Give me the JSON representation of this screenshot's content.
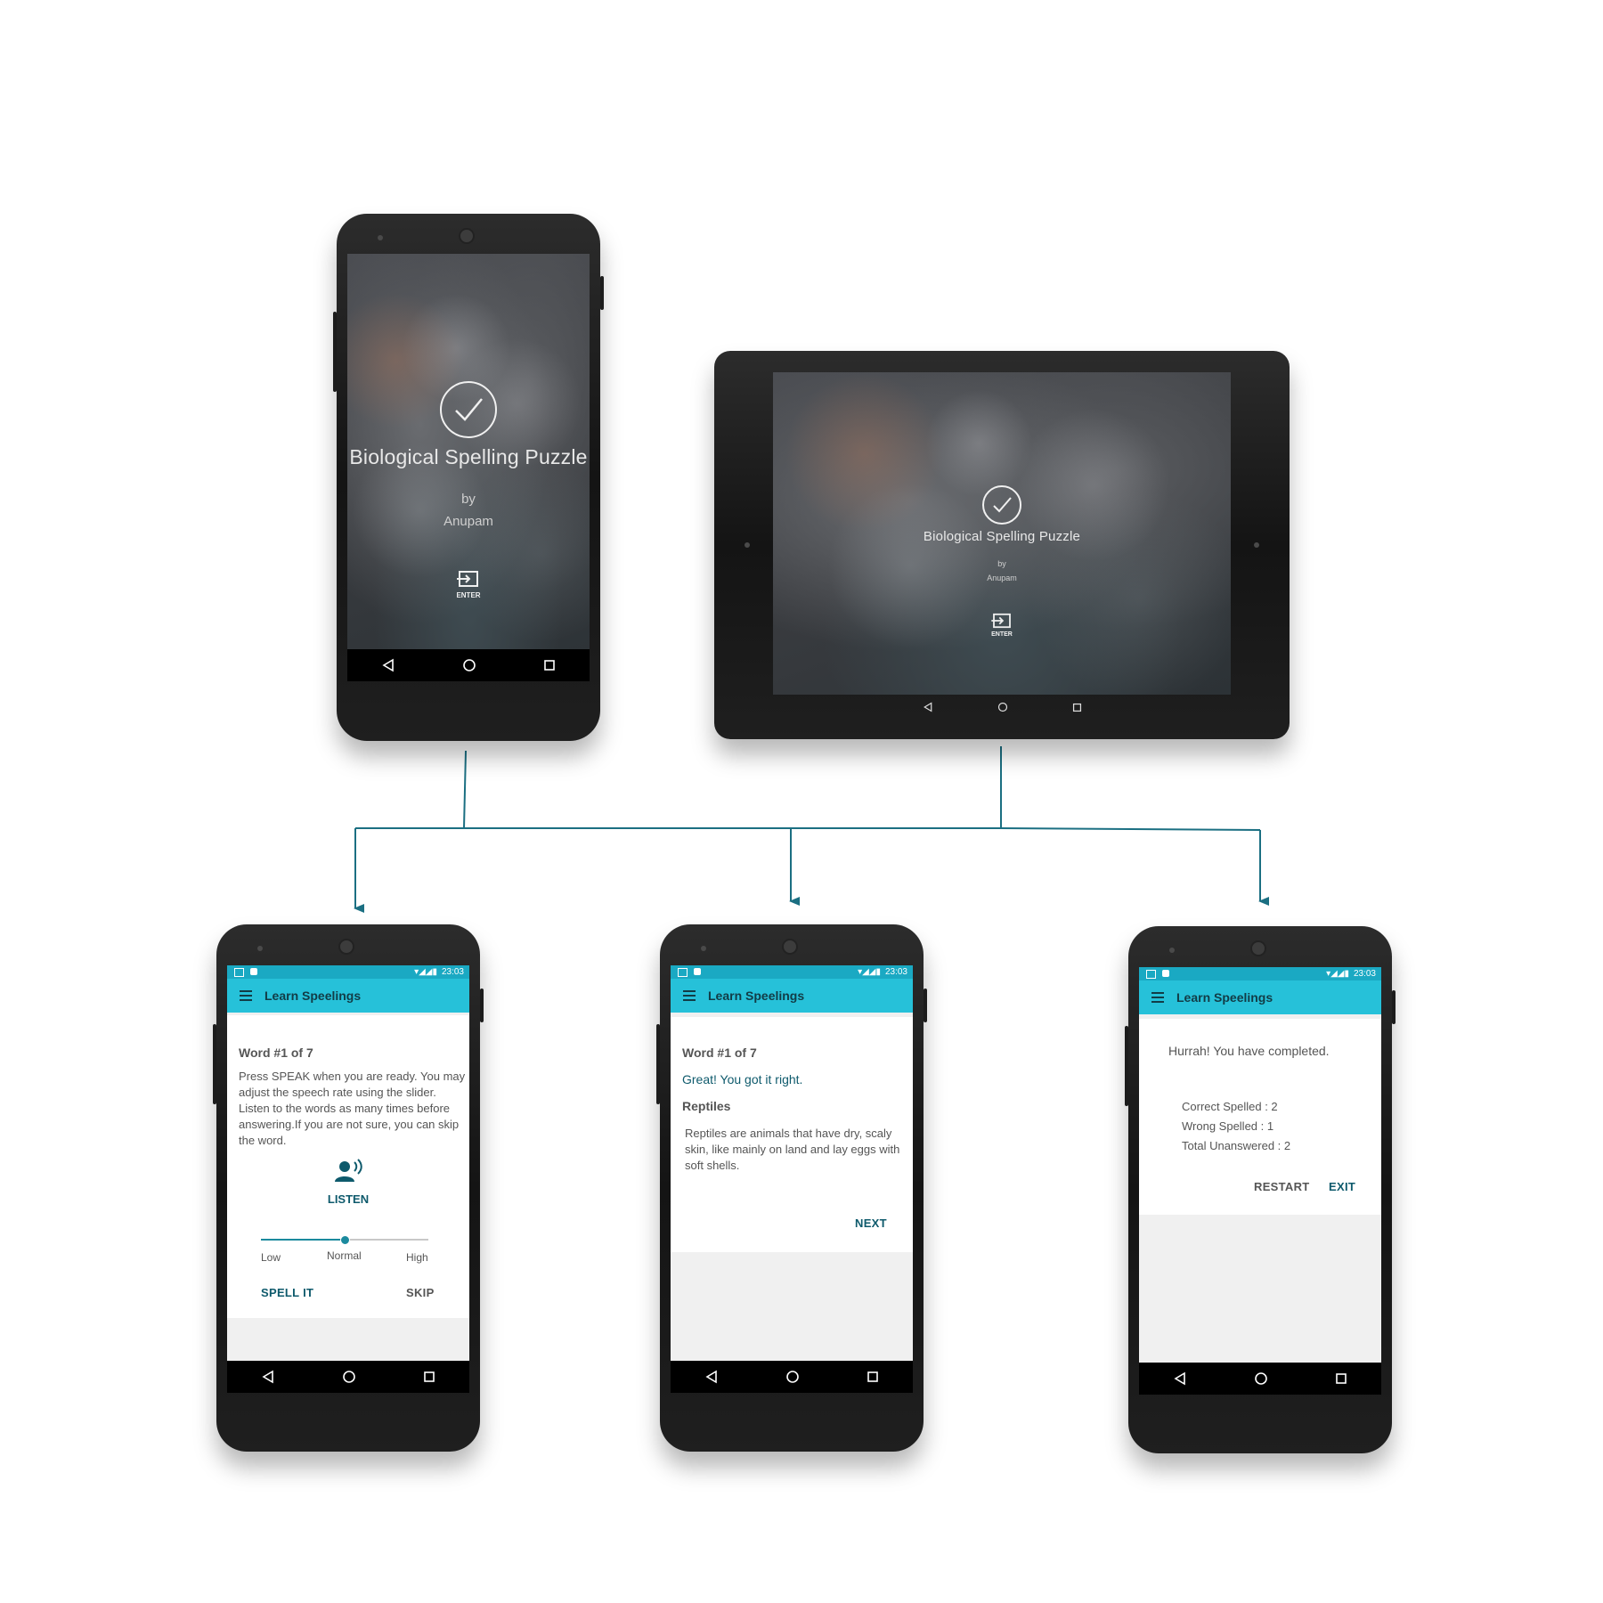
{
  "splash": {
    "title": "Biological Spelling Puzzle",
    "by": "by",
    "author": "Anupam",
    "enter_label": "ENTER"
  },
  "statusbar": {
    "time": "23:03"
  },
  "app": {
    "toolbar_title": "Learn Speelings"
  },
  "screen_listen": {
    "word_counter": "Word #1 of 7",
    "instructions": "Press SPEAK when you are ready. You may adjust the speech rate using the slider. Listen to the words as many times before  answering.If you are not sure, you can skip the word.",
    "listen_label": "LISTEN",
    "slider": {
      "low": "Low",
      "normal": "Normal",
      "high": "High",
      "value": 0.5
    },
    "spell_button": "SPELL IT",
    "skip_button": "SKIP"
  },
  "screen_result": {
    "word_counter": "Word #1 of 7",
    "feedback": "Great! You got it right.",
    "word": "Reptiles",
    "definition": "Reptiles are animals that have dry, scaly skin, like mainly on land and lay eggs with soft shells.",
    "next_button": "NEXT"
  },
  "screen_complete": {
    "message": "Hurrah! You have completed.",
    "correct": "Correct Spelled : 2",
    "wrong": "Wrong Spelled : 1",
    "unanswered": "Total Unanswered : 2",
    "restart_button": "RESTART",
    "exit_button": "EXIT"
  },
  "colors": {
    "connector": "#1b6f82",
    "toolbar": "#26c1d9",
    "statusbar": "#1aa9c3",
    "accent_text": "#0e5a6c"
  }
}
